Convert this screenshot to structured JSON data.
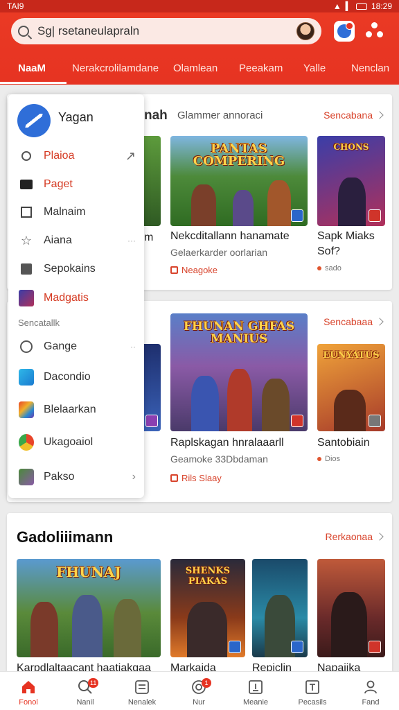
{
  "status_bar": {
    "left_text": "TAI9",
    "time": "18:29"
  },
  "search": {
    "text": "Sg| rsetaneulapraln"
  },
  "tabs": [
    "NaaM",
    "Nerakcrolilamdane",
    "Olamlean",
    "Peeakam",
    "Yalle",
    "Nenclan"
  ],
  "drawer": {
    "title": "Yagan",
    "items": [
      {
        "label": "Plaioa",
        "icon": "search-icon",
        "highlight": true
      },
      {
        "label": "Paget",
        "icon": "card-icon",
        "highlight": true
      },
      {
        "label": "Malnaim",
        "icon": "square-icon",
        "highlight": false
      },
      {
        "label": "Aiana",
        "icon": "star-icon",
        "highlight": false
      },
      {
        "label": "Sepokains",
        "icon": "grid-icon",
        "highlight": false
      },
      {
        "label": "Madgatis",
        "icon": "game-thumb-icon",
        "highlight": true
      }
    ],
    "section_label": "Sencatallk",
    "section_items": [
      {
        "label": "Gange",
        "icon": "chat-icon"
      },
      {
        "label": "Dacondio",
        "icon": "app-blue-icon"
      },
      {
        "label": "Blelaarkan",
        "icon": "app-colorful-icon"
      },
      {
        "label": "Ukagoaiol",
        "icon": "chrome-icon"
      },
      {
        "label": "Pakso",
        "icon": "game-small-icon"
      }
    ]
  },
  "section1": {
    "heading_tail": "nah",
    "subheading": "Glammer annoraci",
    "link": "Sencabana",
    "cards": [
      {
        "art": "PANTAS COMPERING",
        "title": "Nekcditallann hanamate",
        "sub": "Gelaerkarder oorlarian",
        "meta": "Neagoke"
      },
      {
        "art": "CHONS",
        "title": "Sapk Miaks",
        "title2": "Sof?",
        "meta": "sado"
      }
    ],
    "left_fragment": "m"
  },
  "section2": {
    "link": "Sencabaaa",
    "cards": [
      {
        "art": "FHUNAN GHFAS MANIUS",
        "title": "Raplskagan hnralaaarll",
        "sub": "Geamoke 33Dbdaman",
        "meta": "Rils Slaay"
      },
      {
        "art": "EUNYATUS",
        "title": "Santobiain",
        "meta": "Dios"
      }
    ]
  },
  "section3": {
    "heading": "Gadoliiimann",
    "link": "Rerkaonaa",
    "cards": [
      {
        "art": "FHUNAJ",
        "title": "Karpdlaltaacant haatiakgaa"
      },
      {
        "art": "SHENKS PIAKAS",
        "title": "Markaida"
      },
      {
        "art": "",
        "title": "Repiclin"
      },
      {
        "art": "",
        "title": "Napaiika"
      }
    ]
  },
  "bottom_nav": [
    {
      "label": "Fonol",
      "icon": "home-icon",
      "active": true
    },
    {
      "label": "Nanil",
      "icon": "search-icon",
      "badge": "11"
    },
    {
      "label": "Nenalek",
      "icon": "list-icon"
    },
    {
      "label": "Nur",
      "icon": "face-icon",
      "badge": "1"
    },
    {
      "label": "Meanie",
      "icon": "download-icon"
    },
    {
      "label": "Pecasils",
      "icon": "tag-icon"
    },
    {
      "label": "Fand",
      "icon": "person-icon"
    }
  ],
  "colors": {
    "brand": "#e63322",
    "accent_text": "#d8432b",
    "drawer_logo": "#2f6ed8"
  }
}
